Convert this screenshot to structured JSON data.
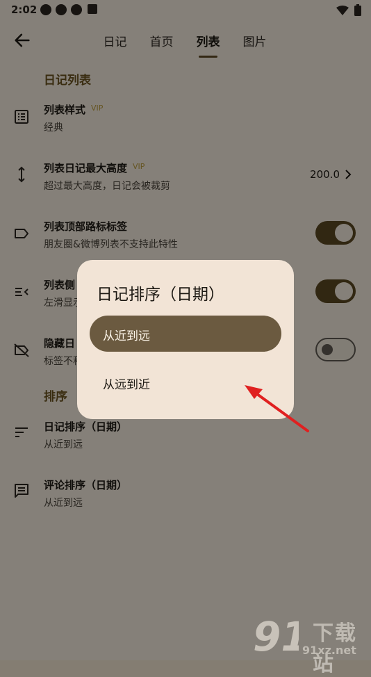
{
  "status_bar": {
    "time": "2:02"
  },
  "app_bar": {
    "tabs": [
      {
        "label": "日记"
      },
      {
        "label": "首页"
      },
      {
        "label": "列表"
      },
      {
        "label": "图片"
      }
    ],
    "active_tab": "列表"
  },
  "sections": {
    "diary_list": "日记列表",
    "sort": "排序"
  },
  "settings": {
    "list_style": {
      "title": "列表样式",
      "badge": "VIP",
      "subtitle": "经典"
    },
    "max_height": {
      "title": "列表日记最大高度",
      "badge": "VIP",
      "subtitle": "超过最大高度，日记会被裁剪",
      "value": "200.0"
    },
    "top_tags": {
      "title": "列表顶部路标标签",
      "subtitle": "朋友圈&微博列表不支持此特性",
      "enabled": true
    },
    "side": {
      "title": "列表侧",
      "subtitle": "左滑显示",
      "enabled": true
    },
    "hide": {
      "title": "隐藏日",
      "subtitle": "标签不积",
      "enabled": false
    },
    "diary_sort": {
      "title": "日记排序（日期）",
      "subtitle": "从近到远"
    },
    "comment_sort": {
      "title": "评论排序（日期）",
      "subtitle": "从近到远"
    }
  },
  "dialog": {
    "title": "日记排序（日期）",
    "options": [
      {
        "label": "从近到远",
        "selected": true
      },
      {
        "label": "从远到近",
        "selected": false
      }
    ]
  },
  "watermark": {
    "text": "下载站",
    "url": "91xz.net"
  },
  "colors": {
    "background": "#f2e9dc",
    "accent": "#5a4722",
    "selected_option": "#6b5a40",
    "annotation_arrow": "#e02020"
  }
}
